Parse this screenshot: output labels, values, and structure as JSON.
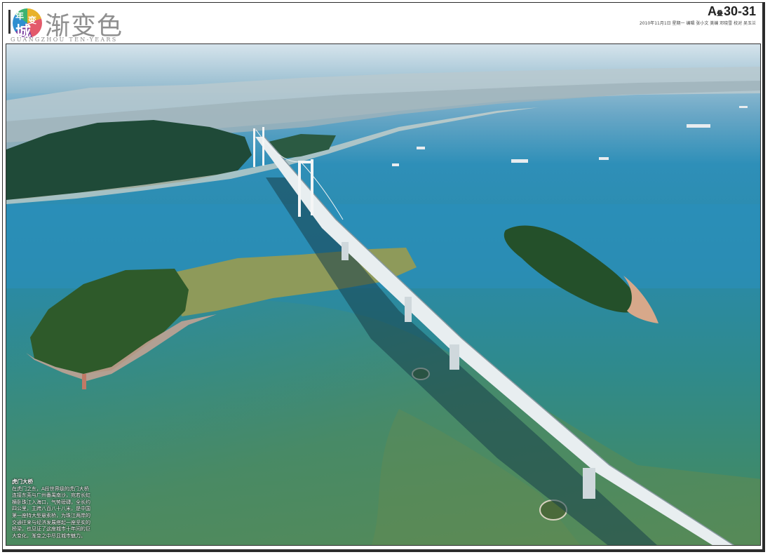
{
  "masthead": {
    "logo_char_1": "年",
    "logo_char_2": "城",
    "logo_char_3": "变",
    "section_title": "渐变色",
    "section_subtitle": "GUANGZHOU  TEN-YEARS",
    "page_prefix": "A",
    "page_prefix_small": "叠",
    "page_number": "30-31",
    "issue_line": "2010年11月1日  星期一  编辑 张小文  美编 邓晓雪  校对 吴玉兰"
  },
  "caption": {
    "title": "虎门大桥",
    "body": "在虎门之东，A段世界级的虎门大桥连接东莞与广州番禺南沙，宛若长虹横卧珠江入海口，气势磅礴，全长约四公里，主跨八百八十八米，是中国第一座特大型悬索桥，为珠江两岸的交通往来与经济发展搭起一座坚实的桥梁，也见证了这座城市十年间的巨大变化，渐变之中尽显城市魅力。"
  },
  "colors": {
    "sea_deep": "#2e8fb8",
    "sea_muddy": "#4a8a5e",
    "island_green": "#2f5a2a",
    "bridge_white": "#e8eef0"
  }
}
